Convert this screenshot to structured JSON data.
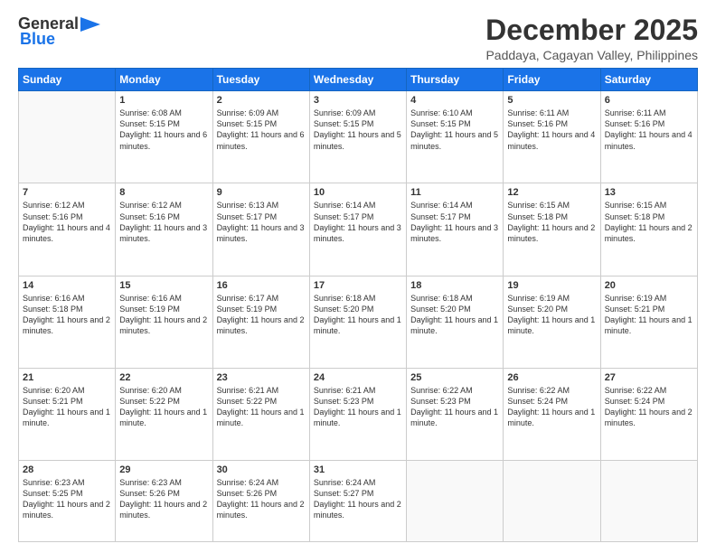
{
  "logo": {
    "text_general": "General",
    "text_blue": "Blue",
    "icon": "▶"
  },
  "header": {
    "month": "December 2025",
    "location": "Paddaya, Cagayan Valley, Philippines"
  },
  "weekdays": [
    "Sunday",
    "Monday",
    "Tuesday",
    "Wednesday",
    "Thursday",
    "Friday",
    "Saturday"
  ],
  "weeks": [
    [
      {
        "day": "",
        "sunrise": "",
        "sunset": "",
        "daylight": ""
      },
      {
        "day": "1",
        "sunrise": "Sunrise: 6:08 AM",
        "sunset": "Sunset: 5:15 PM",
        "daylight": "Daylight: 11 hours and 6 minutes."
      },
      {
        "day": "2",
        "sunrise": "Sunrise: 6:09 AM",
        "sunset": "Sunset: 5:15 PM",
        "daylight": "Daylight: 11 hours and 6 minutes."
      },
      {
        "day": "3",
        "sunrise": "Sunrise: 6:09 AM",
        "sunset": "Sunset: 5:15 PM",
        "daylight": "Daylight: 11 hours and 5 minutes."
      },
      {
        "day": "4",
        "sunrise": "Sunrise: 6:10 AM",
        "sunset": "Sunset: 5:15 PM",
        "daylight": "Daylight: 11 hours and 5 minutes."
      },
      {
        "day": "5",
        "sunrise": "Sunrise: 6:11 AM",
        "sunset": "Sunset: 5:16 PM",
        "daylight": "Daylight: 11 hours and 4 minutes."
      },
      {
        "day": "6",
        "sunrise": "Sunrise: 6:11 AM",
        "sunset": "Sunset: 5:16 PM",
        "daylight": "Daylight: 11 hours and 4 minutes."
      }
    ],
    [
      {
        "day": "7",
        "sunrise": "Sunrise: 6:12 AM",
        "sunset": "Sunset: 5:16 PM",
        "daylight": "Daylight: 11 hours and 4 minutes."
      },
      {
        "day": "8",
        "sunrise": "Sunrise: 6:12 AM",
        "sunset": "Sunset: 5:16 PM",
        "daylight": "Daylight: 11 hours and 3 minutes."
      },
      {
        "day": "9",
        "sunrise": "Sunrise: 6:13 AM",
        "sunset": "Sunset: 5:17 PM",
        "daylight": "Daylight: 11 hours and 3 minutes."
      },
      {
        "day": "10",
        "sunrise": "Sunrise: 6:14 AM",
        "sunset": "Sunset: 5:17 PM",
        "daylight": "Daylight: 11 hours and 3 minutes."
      },
      {
        "day": "11",
        "sunrise": "Sunrise: 6:14 AM",
        "sunset": "Sunset: 5:17 PM",
        "daylight": "Daylight: 11 hours and 3 minutes."
      },
      {
        "day": "12",
        "sunrise": "Sunrise: 6:15 AM",
        "sunset": "Sunset: 5:18 PM",
        "daylight": "Daylight: 11 hours and 2 minutes."
      },
      {
        "day": "13",
        "sunrise": "Sunrise: 6:15 AM",
        "sunset": "Sunset: 5:18 PM",
        "daylight": "Daylight: 11 hours and 2 minutes."
      }
    ],
    [
      {
        "day": "14",
        "sunrise": "Sunrise: 6:16 AM",
        "sunset": "Sunset: 5:18 PM",
        "daylight": "Daylight: 11 hours and 2 minutes."
      },
      {
        "day": "15",
        "sunrise": "Sunrise: 6:16 AM",
        "sunset": "Sunset: 5:19 PM",
        "daylight": "Daylight: 11 hours and 2 minutes."
      },
      {
        "day": "16",
        "sunrise": "Sunrise: 6:17 AM",
        "sunset": "Sunset: 5:19 PM",
        "daylight": "Daylight: 11 hours and 2 minutes."
      },
      {
        "day": "17",
        "sunrise": "Sunrise: 6:18 AM",
        "sunset": "Sunset: 5:20 PM",
        "daylight": "Daylight: 11 hours and 1 minute."
      },
      {
        "day": "18",
        "sunrise": "Sunrise: 6:18 AM",
        "sunset": "Sunset: 5:20 PM",
        "daylight": "Daylight: 11 hours and 1 minute."
      },
      {
        "day": "19",
        "sunrise": "Sunrise: 6:19 AM",
        "sunset": "Sunset: 5:20 PM",
        "daylight": "Daylight: 11 hours and 1 minute."
      },
      {
        "day": "20",
        "sunrise": "Sunrise: 6:19 AM",
        "sunset": "Sunset: 5:21 PM",
        "daylight": "Daylight: 11 hours and 1 minute."
      }
    ],
    [
      {
        "day": "21",
        "sunrise": "Sunrise: 6:20 AM",
        "sunset": "Sunset: 5:21 PM",
        "daylight": "Daylight: 11 hours and 1 minute."
      },
      {
        "day": "22",
        "sunrise": "Sunrise: 6:20 AM",
        "sunset": "Sunset: 5:22 PM",
        "daylight": "Daylight: 11 hours and 1 minute."
      },
      {
        "day": "23",
        "sunrise": "Sunrise: 6:21 AM",
        "sunset": "Sunset: 5:22 PM",
        "daylight": "Daylight: 11 hours and 1 minute."
      },
      {
        "day": "24",
        "sunrise": "Sunrise: 6:21 AM",
        "sunset": "Sunset: 5:23 PM",
        "daylight": "Daylight: 11 hours and 1 minute."
      },
      {
        "day": "25",
        "sunrise": "Sunrise: 6:22 AM",
        "sunset": "Sunset: 5:23 PM",
        "daylight": "Daylight: 11 hours and 1 minute."
      },
      {
        "day": "26",
        "sunrise": "Sunrise: 6:22 AM",
        "sunset": "Sunset: 5:24 PM",
        "daylight": "Daylight: 11 hours and 1 minute."
      },
      {
        "day": "27",
        "sunrise": "Sunrise: 6:22 AM",
        "sunset": "Sunset: 5:24 PM",
        "daylight": "Daylight: 11 hours and 2 minutes."
      }
    ],
    [
      {
        "day": "28",
        "sunrise": "Sunrise: 6:23 AM",
        "sunset": "Sunset: 5:25 PM",
        "daylight": "Daylight: 11 hours and 2 minutes."
      },
      {
        "day": "29",
        "sunrise": "Sunrise: 6:23 AM",
        "sunset": "Sunset: 5:26 PM",
        "daylight": "Daylight: 11 hours and 2 minutes."
      },
      {
        "day": "30",
        "sunrise": "Sunrise: 6:24 AM",
        "sunset": "Sunset: 5:26 PM",
        "daylight": "Daylight: 11 hours and 2 minutes."
      },
      {
        "day": "31",
        "sunrise": "Sunrise: 6:24 AM",
        "sunset": "Sunset: 5:27 PM",
        "daylight": "Daylight: 11 hours and 2 minutes."
      },
      {
        "day": "",
        "sunrise": "",
        "sunset": "",
        "daylight": ""
      },
      {
        "day": "",
        "sunrise": "",
        "sunset": "",
        "daylight": ""
      },
      {
        "day": "",
        "sunrise": "",
        "sunset": "",
        "daylight": ""
      }
    ]
  ]
}
